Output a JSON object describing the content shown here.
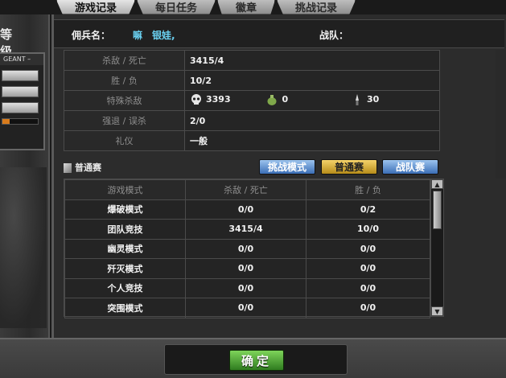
{
  "tabs": [
    {
      "label": "游戏记录",
      "active": true
    },
    {
      "label": "每日任务",
      "active": false
    },
    {
      "label": "徽章",
      "active": false
    },
    {
      "label": "挑战记录",
      "active": false
    }
  ],
  "left": {
    "title": "等级",
    "rank_bar": "GEANT –",
    "progress_fraction": 0.2
  },
  "header": {
    "mercenary_label": "佣兵名：",
    "mercenary_value": "嘛　银娃,",
    "clan_label": "战队："
  },
  "stats": {
    "kd_label": "杀敌 / 死亡",
    "kd_value": "3415/4",
    "wl_label": "胜 / 负",
    "wl_value": "10/2",
    "special_label": "特殊杀敌",
    "special": [
      {
        "icon": "skull-icon",
        "value": "3393"
      },
      {
        "icon": "grenade-icon",
        "value": "0"
      },
      {
        "icon": "knife-icon",
        "value": "30"
      }
    ],
    "quit_label": "强退 / 误杀",
    "quit_value": "2/0",
    "etiquette_label": "礼仪",
    "etiquette_value": "一般"
  },
  "mode_section": {
    "title": "普通赛",
    "buttons": [
      "挑战模式",
      "普通赛",
      "战队赛"
    ]
  },
  "modes_table": {
    "headers": [
      "游戏模式",
      "杀敌 / 死亡",
      "胜 / 负"
    ],
    "rows": [
      [
        "爆破模式",
        "0/0",
        "0/2"
      ],
      [
        "团队竞技",
        "3415/4",
        "10/0"
      ],
      [
        "幽灵模式",
        "0/0",
        "0/0"
      ],
      [
        "歼灭模式",
        "0/0",
        "0/0"
      ],
      [
        "个人竞技",
        "0/0",
        "0/0"
      ],
      [
        "突围模式",
        "0/0",
        "0/0"
      ]
    ]
  },
  "footer": {
    "ok_label": "确定"
  },
  "colors": {
    "accent_name": "#6ad0f0",
    "button_blue": "#3b6fb6",
    "button_gold": "#b78d1a",
    "ok_green": "#2f7c1f"
  }
}
